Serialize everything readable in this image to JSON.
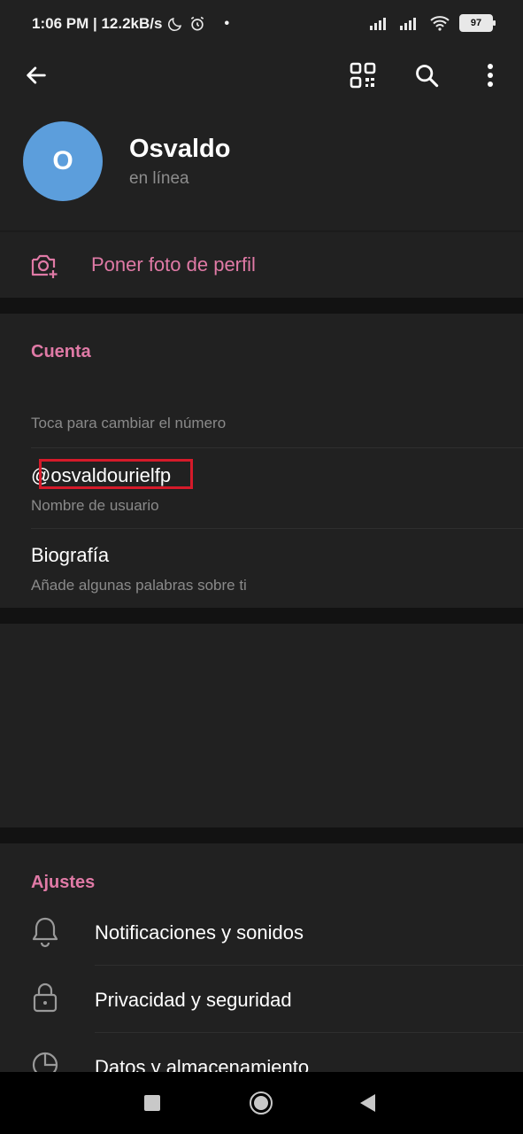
{
  "status_bar": {
    "time_text": "1:06 PM | 12.2kB/s",
    "battery": "97"
  },
  "toolbar": {
    "back_icon": "arrow-left-icon",
    "qr_icon": "qr-code-icon",
    "search_icon": "search-icon",
    "more_icon": "more-vertical-icon"
  },
  "profile": {
    "avatar_initial": "O",
    "avatar_color": "#5c9edc",
    "name": "Osvaldo",
    "status": "en línea"
  },
  "set_photo": {
    "label": "Poner foto de perfil"
  },
  "account": {
    "title": "Cuenta",
    "phone_hint": "Toca para cambiar el número",
    "username": "@osvaldourielfp",
    "username_hint": "Nombre de usuario",
    "bio": "Biografía",
    "bio_hint": "Añade algunas palabras sobre ti"
  },
  "settings": {
    "title": "Ajustes",
    "items": [
      {
        "label": "Notificaciones y sonidos",
        "icon": "bell-icon"
      },
      {
        "label": "Privacidad y seguridad",
        "icon": "lock-icon"
      },
      {
        "label": "Datos y almacenamiento",
        "icon": "pie-chart-icon"
      }
    ]
  },
  "colors": {
    "accent": "#e07aa6",
    "highlight_box": "#d51a2a"
  }
}
